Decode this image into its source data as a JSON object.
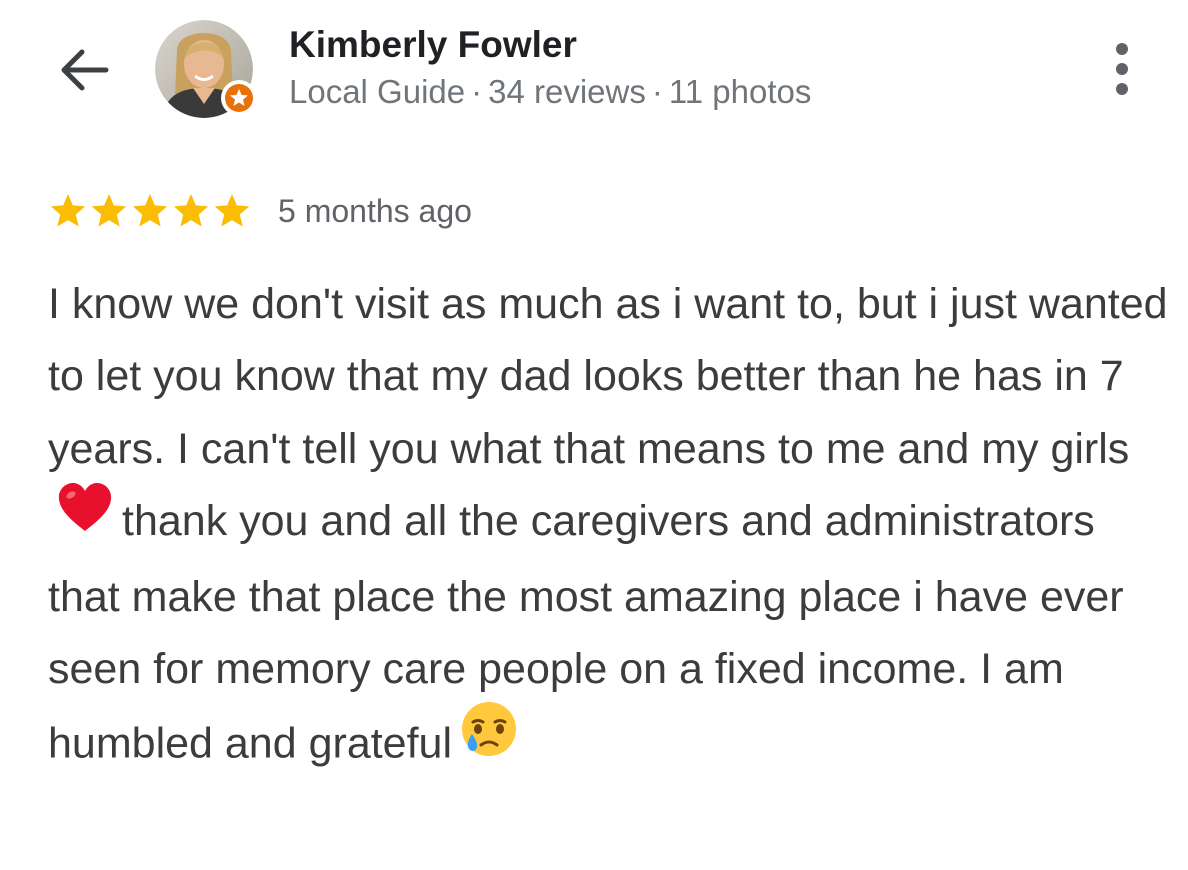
{
  "header": {
    "back_icon": "arrow-back-icon",
    "reviewer_name": "Kimberly Fowler",
    "reviewer_badge": "Local Guide",
    "separator": "·",
    "reviews_count": "34 reviews",
    "photos_count": "11 photos",
    "more_icon": "more-vert-icon"
  },
  "review": {
    "rating": 5,
    "rating_max": 5,
    "date": "5 months ago",
    "text_part1": "I know we don't visit as much as i want to, but i just wanted to let you know that my dad looks better than he has in 7 years. I can't tell you what that means to me and my girls",
    "emoji1": "red-heart-emoji",
    "text_part2": "thank you and all the caregivers and administrators that make that place the most amazing place i have ever seen for memory care people on a fixed income. I am humbled and grateful",
    "emoji2": "face-holding-back-tears-emoji"
  },
  "colors": {
    "star": "#fbbc04",
    "badge": "#e8710a",
    "heart": "#e8112d",
    "emoji_face": "#ffc83d"
  }
}
